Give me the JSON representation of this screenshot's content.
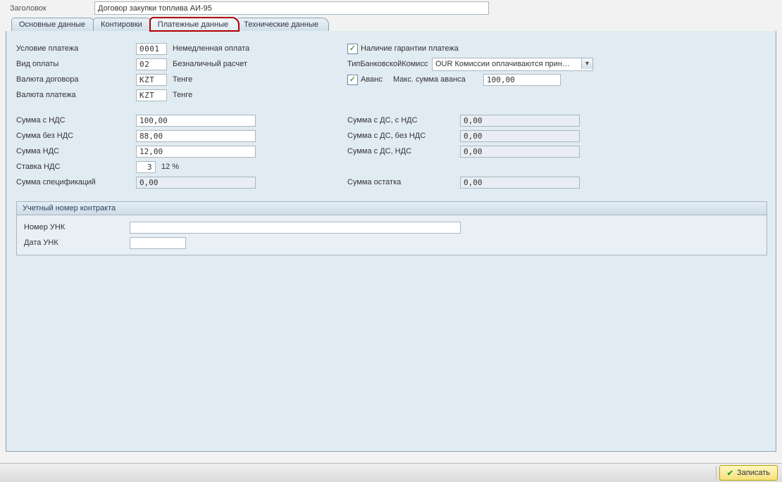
{
  "header": {
    "label": "Заголовок",
    "value": "Договор закупки топлива АИ-95"
  },
  "tabs": [
    {
      "label": "Основные данные"
    },
    {
      "label": "Контировки"
    },
    {
      "label": "Платежные данные"
    },
    {
      "label": "Технические данные"
    }
  ],
  "left": {
    "payment_condition": {
      "label": "Условие платежа",
      "value": "0001",
      "text": "Немедленная оплата"
    },
    "payment_type": {
      "label": "Вид оплаты",
      "value": "02",
      "text": "Безналичный расчет"
    },
    "contract_currency": {
      "label": "Валюта договора",
      "value": "KZT",
      "text": "Тенге"
    },
    "payment_currency": {
      "label": "Валюта платежа",
      "value": "KZT",
      "text": "Тенге"
    },
    "sum_with_vat": {
      "label": "Сумма с НДС",
      "value": "100,00"
    },
    "sum_without_vat": {
      "label": "Сумма без НДС",
      "value": "88,00"
    },
    "sum_vat": {
      "label": "Сумма НДС",
      "value": "12,00"
    },
    "vat_rate": {
      "label": "Ставка НДС",
      "value": "3",
      "text": "12 %"
    },
    "sum_specs": {
      "label": "Сумма спецификаций",
      "value": "0,00"
    }
  },
  "right": {
    "guarantee": {
      "label": "Наличие гарантии платежа",
      "checked": true
    },
    "bank_commission": {
      "label": "ТипБанковскойКомисс",
      "value": "OUR Комиссии оплачиваются прин…"
    },
    "advance": {
      "label": "Аванс",
      "checked": true,
      "max_label": "Макс. сумма аванса",
      "max_value": "100,00"
    },
    "ds_with_vat": {
      "label": "Сумма с ДС, с НДС",
      "value": "0,00"
    },
    "ds_without_vat": {
      "label": "Сумма с ДС, без НДС",
      "value": "0,00"
    },
    "ds_vat": {
      "label": "Сумма с ДС, НДС",
      "value": "0,00"
    },
    "balance": {
      "label": "Сумма остатка",
      "value": "0,00"
    }
  },
  "group": {
    "title": "Учетный номер контракта",
    "unk_number": {
      "label": "Номер УНК",
      "value": ""
    },
    "unk_date": {
      "label": "Дата УНК",
      "value": ""
    }
  },
  "footer": {
    "save": "Записать"
  }
}
